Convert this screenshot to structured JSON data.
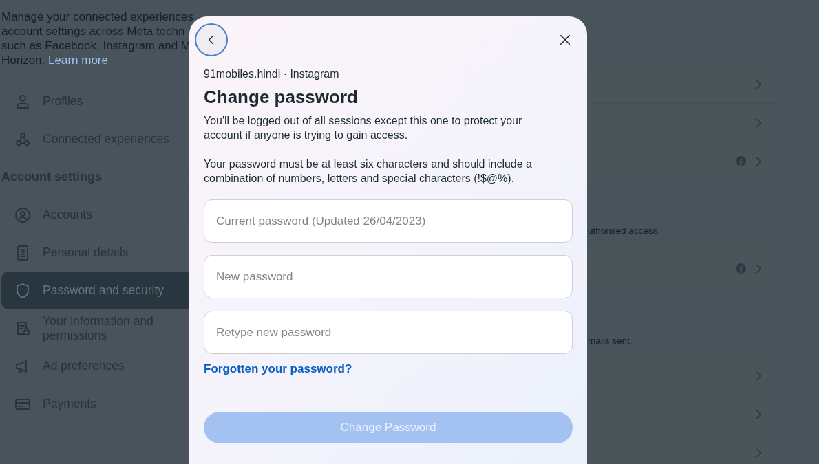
{
  "sidebar": {
    "description": [
      "Manage your connected experiences",
      "account settings across Meta techn",
      "such as Facebook, Instagram and M",
      "Horizon. "
    ],
    "learn_more": "Learn more",
    "items": [
      {
        "kind": "item",
        "label": "Profiles",
        "selected": false
      },
      {
        "kind": "item",
        "label": "Connected experiences",
        "selected": false
      },
      {
        "kind": "heading",
        "label": "Account settings"
      },
      {
        "kind": "item",
        "label": "Accounts",
        "selected": false
      },
      {
        "kind": "item",
        "label": "Personal details",
        "selected": false
      },
      {
        "kind": "item",
        "label": "Password and security",
        "selected": true
      },
      {
        "kind": "item",
        "label": "Your information and permissions",
        "selected": false
      },
      {
        "kind": "item",
        "label": "Ad preferences",
        "selected": false
      },
      {
        "kind": "item",
        "label": "Payments",
        "selected": false
      }
    ]
  },
  "main": {
    "groups": [
      {
        "rows": [
          {
            "meta_icon": false
          },
          {
            "meta_icon": false
          },
          {
            "meta_icon": true
          }
        ]
      },
      {
        "note": "uthorised access.",
        "rows": [
          {
            "meta_icon": true
          }
        ]
      },
      {
        "note": "mails sent.",
        "rows": [
          {
            "meta_icon": false
          },
          {
            "meta_icon": false
          },
          {
            "meta_icon": false
          }
        ]
      }
    ]
  },
  "modal": {
    "account": "91mobiles.hindi · Instagram",
    "title": "Change password",
    "paragraphs": [
      "You'll be logged out of all sessions except this one to protect your account if anyone is trying to gain access.",
      "Your password must be at least six characters and should include a combination of numbers, letters and special characters (!$@%)."
    ],
    "fields": [
      {
        "placeholder": "Current password (Updated 26/04/2023)"
      },
      {
        "placeholder": "New password"
      },
      {
        "placeholder": "Retype new password"
      }
    ],
    "forgot_link": "Forgotten your password?",
    "submit": {
      "label": "Change Password",
      "disabled": true
    }
  }
}
